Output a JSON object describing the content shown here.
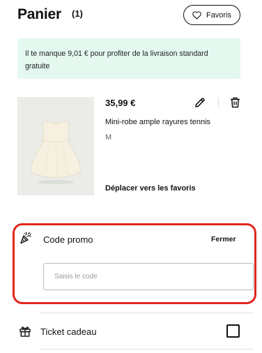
{
  "header": {
    "title": "Panier",
    "count": "(1)",
    "favorites_button": "Favoris"
  },
  "banner": {
    "text": "Il te manque 9,01 € pour profiter de la livraison standard gratuite"
  },
  "cart_item": {
    "price": "35,99 €",
    "name": "Mini-robe ample rayures tennis",
    "size": "M",
    "move_to_favorites": "Déplacer vers les favoris"
  },
  "promo": {
    "title": "Code promo",
    "close": "Fermer",
    "placeholder": "Saisis le code",
    "value": ""
  },
  "gift": {
    "label": "Ticket cadeau",
    "checked": false
  },
  "colors": {
    "banner_bg": "#e4f8ef",
    "highlight": "#e0261c",
    "text": "#111111"
  }
}
